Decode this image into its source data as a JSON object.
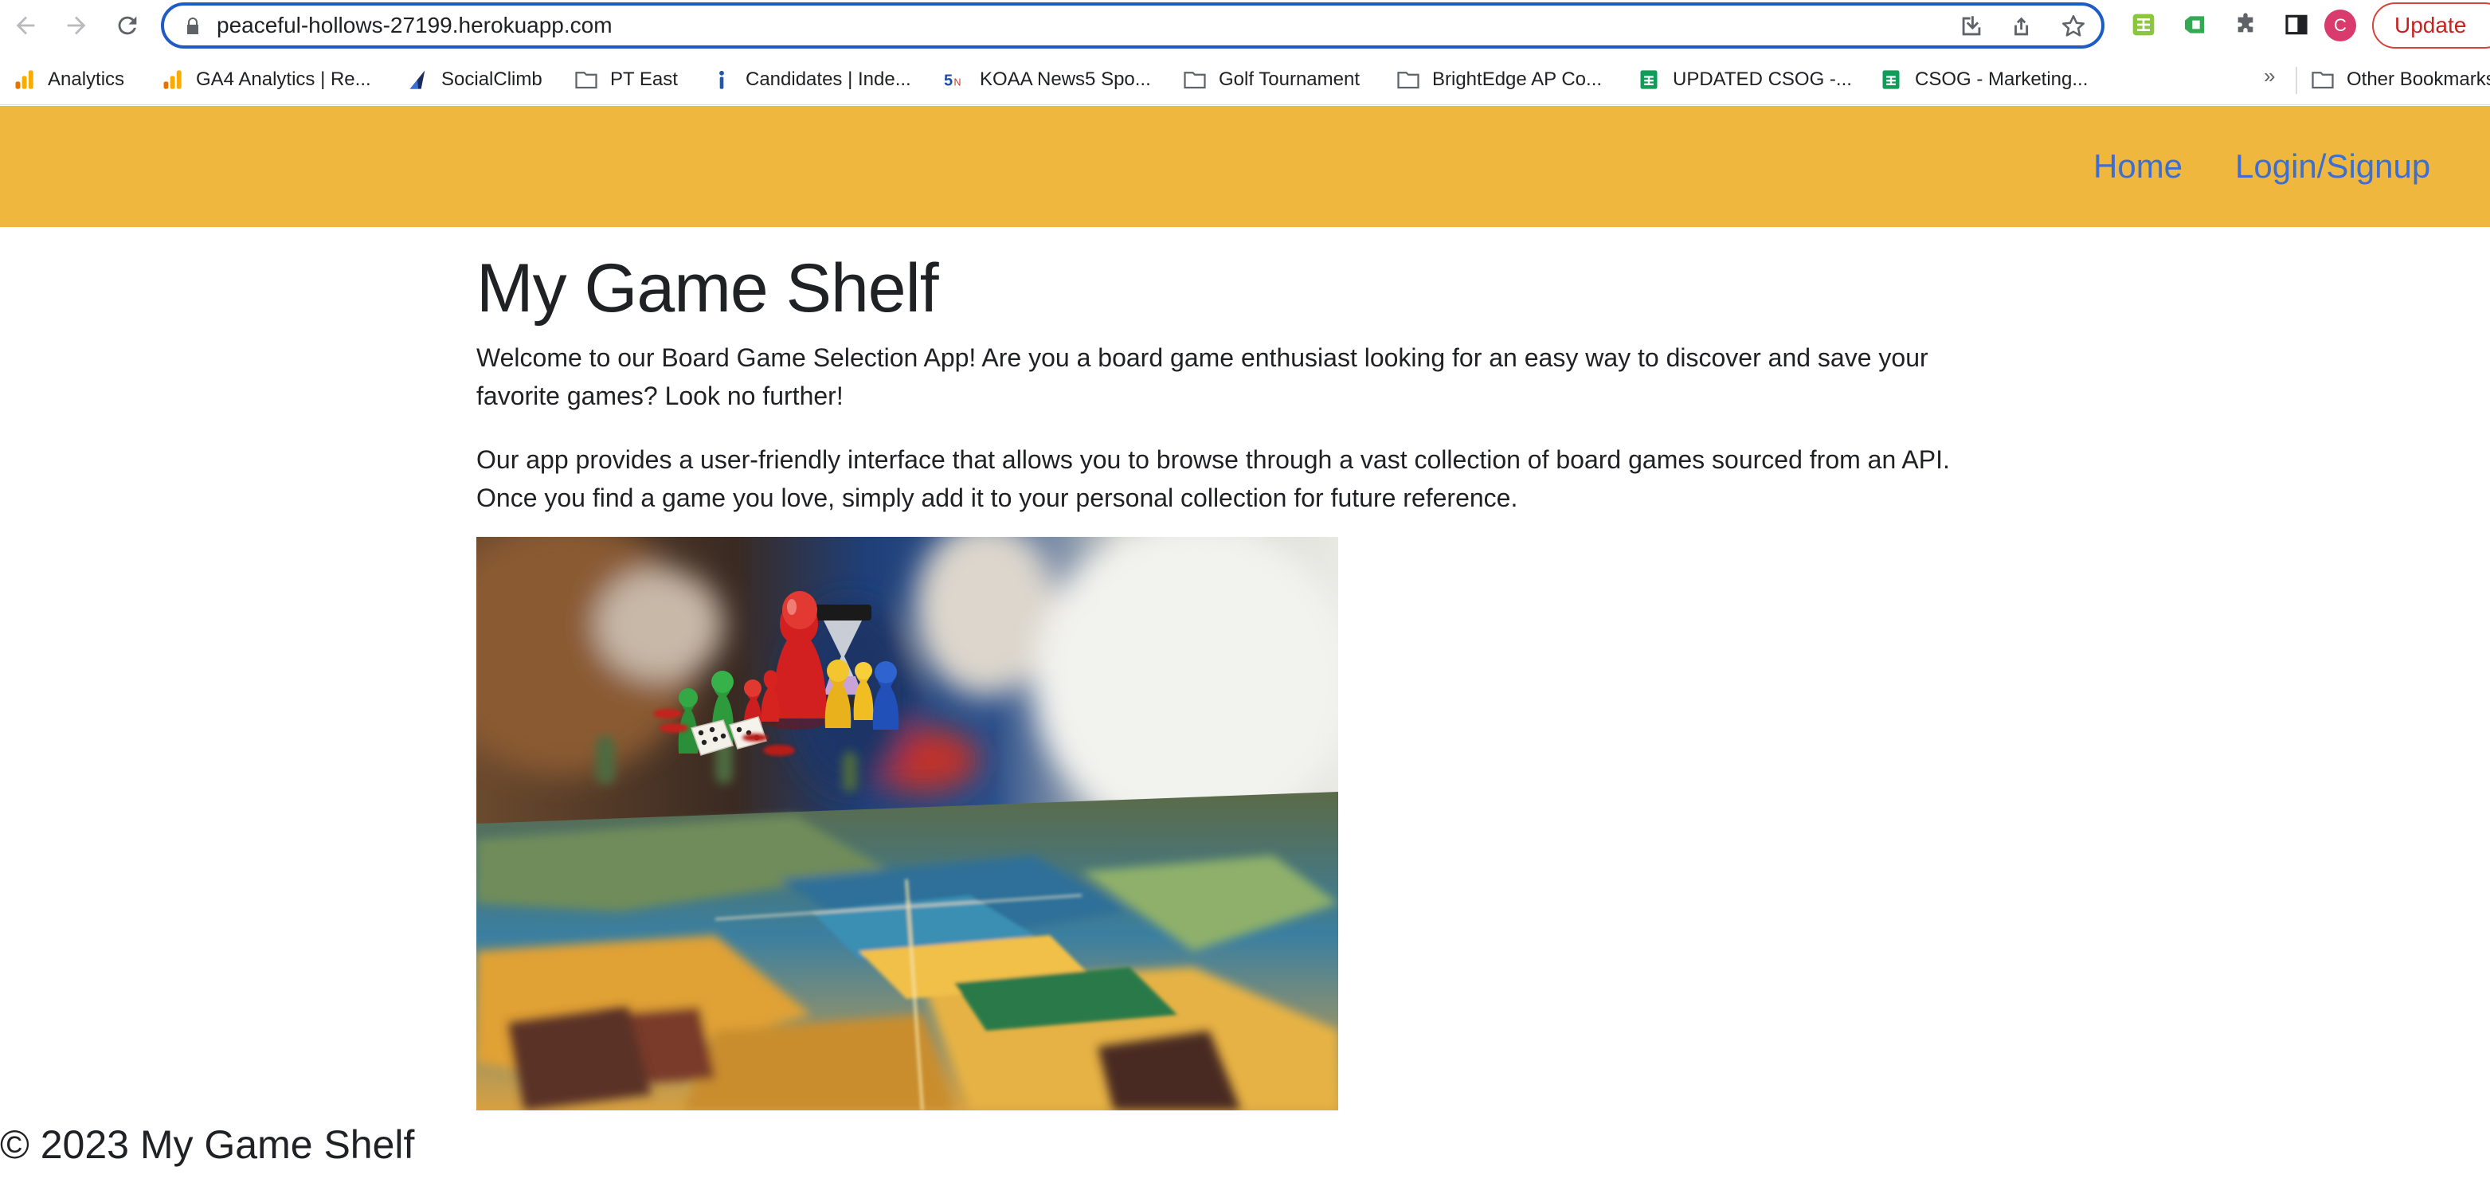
{
  "browser": {
    "url": "peaceful-hollows-27199.herokuapp.com",
    "profile_initial": "C",
    "update_label": "Update"
  },
  "bookmarks": [
    {
      "label": "Analytics",
      "icon": "analytics-icon"
    },
    {
      "label": "GA4 Analytics | Re...",
      "icon": "analytics-icon"
    },
    {
      "label": "SocialClimb",
      "icon": "socialclimb-icon"
    },
    {
      "label": "PT East",
      "icon": "folder-icon"
    },
    {
      "label": "Candidates | Inde...",
      "icon": "indeed-icon"
    },
    {
      "label": "KOAA News5 Spo...",
      "icon": "koaa-icon"
    },
    {
      "label": "Golf Tournament",
      "icon": "folder-icon"
    },
    {
      "label": "BrightEdge AP Co...",
      "icon": "folder-icon"
    },
    {
      "label": "UPDATED CSOG -...",
      "icon": "sheets-icon"
    },
    {
      "label": "CSOG - Marketing...",
      "icon": "sheets-icon"
    }
  ],
  "bookmarks_more": "»",
  "other_bookmarks": "Other Bookmarks",
  "site": {
    "nav": {
      "home": "Home",
      "login": "Login/Signup"
    },
    "title": "My Game Shelf",
    "paragraphs": [
      "Welcome to our Board Game Selection App! Are you a board game enthusiast looking for an easy way to discover and save your favorite games? Look no further!",
      "Our app provides a user-friendly interface that allows you to browse through a vast collection of board games sourced from an API. Once you find a game you love, simply add it to your personal collection for future reference."
    ],
    "footer": "© 2023 My Game Shelf"
  },
  "colors": {
    "nav_bg": "#efb73e",
    "nav_link": "#3e6ed0",
    "omnibox_border": "#1f5bc4"
  }
}
